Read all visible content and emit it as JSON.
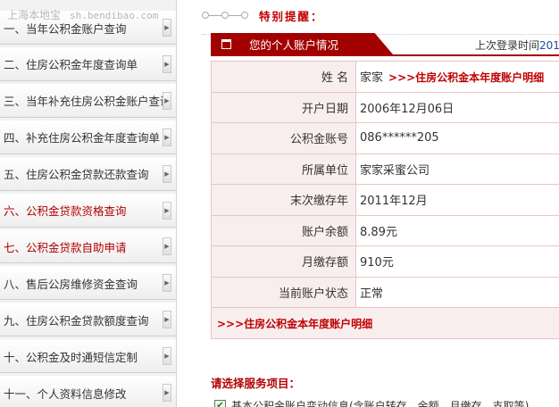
{
  "watermark": {
    "site": "上海本地宝",
    "domain": "sh.bendibao.com"
  },
  "sidebar": {
    "items": [
      {
        "label": "一、当年公积金账户查询",
        "red": false
      },
      {
        "label": "二、住房公积金年度查询单",
        "red": false
      },
      {
        "label": "三、当年补充住房公积金账户查询",
        "red": false
      },
      {
        "label": "四、补充住房公积金年度查询单",
        "red": false
      },
      {
        "label": "五、住房公积金贷款还款查询",
        "red": false
      },
      {
        "label": "六、公积金贷款资格查询",
        "red": true
      },
      {
        "label": "七、公积金贷款自助申请",
        "red": true
      },
      {
        "label": "八、售后公房维修资金查询",
        "red": false
      },
      {
        "label": "九、住房公积金贷款额度查询",
        "red": false
      },
      {
        "label": "十、公积金及时通短信定制",
        "red": false
      },
      {
        "label": "十一、个人资料信息修改",
        "red": false
      }
    ]
  },
  "notice": {
    "title": "特别提醒："
  },
  "account": {
    "tab_title": "您的个人账户情况",
    "last_login_label": "上次登录时间",
    "last_login_value": "201",
    "rows": [
      {
        "key": "姓 名",
        "value": "家家",
        "link": ">>>住房公积金本年度账户明细"
      },
      {
        "key": "开户日期",
        "value": "2006年12月06日"
      },
      {
        "key": "公积金账号",
        "value": "086******205"
      },
      {
        "key": "所属单位",
        "value": "家家采蜜公司"
      },
      {
        "key": "末次缴存年",
        "value": "2011年12月"
      },
      {
        "key": "账户余额",
        "value": "8.89元"
      },
      {
        "key": "月缴存额",
        "value": "910元"
      },
      {
        "key": "当前账户状态",
        "value": "正常"
      }
    ],
    "footer_link": ">>>住房公积金本年度账户明细"
  },
  "services": {
    "heading": "请选择服务项目：",
    "first_item": "基本公积金账户变动信息(含账户转存、余额、月缴存、支取等)"
  }
}
